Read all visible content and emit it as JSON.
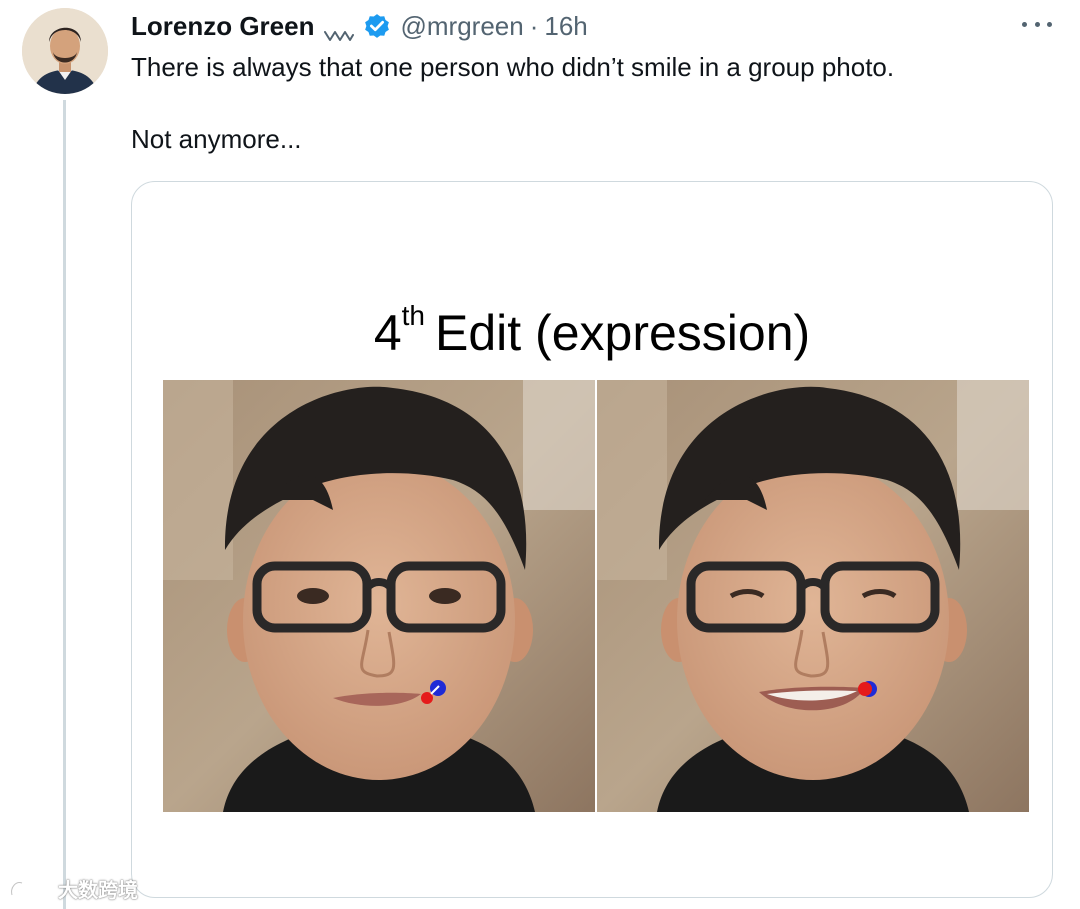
{
  "tweet": {
    "author": {
      "display_name": "Lorenzo Green",
      "handle": "@mrgreen",
      "separator": "·",
      "time": "16h"
    },
    "text_line_1": "There is always that one person who didn’t smile in a group photo.",
    "text_line_2": "Not anymore...",
    "media": {
      "slide_title_number": "4",
      "slide_title_suffix": "th",
      "slide_title_rest": "Edit (expression)"
    }
  },
  "icons": {
    "wave": "wave-icon",
    "verified": "verified-badge-icon",
    "more": "more-options-icon"
  },
  "watermark": {
    "text": "大数跨境"
  },
  "colors": {
    "verified_blue": "#1d9bf0",
    "secondary_text": "#536471",
    "border": "#cfd9de"
  }
}
